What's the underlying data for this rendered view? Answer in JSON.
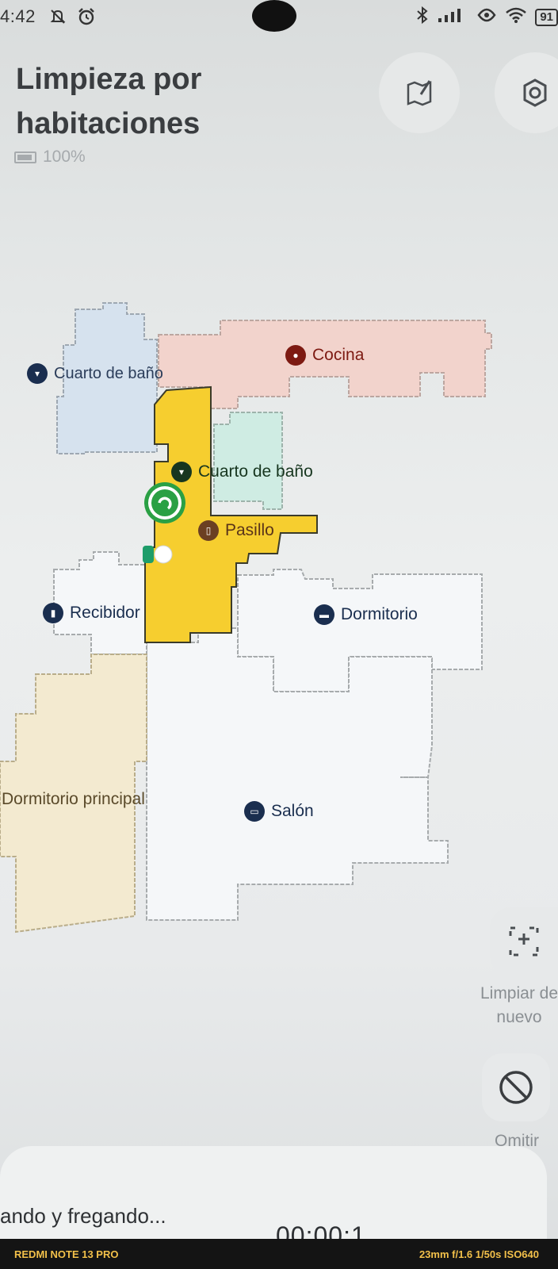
{
  "status_bar": {
    "time": "4:42",
    "battery": "91"
  },
  "header": {
    "title": "Limpieza por habitaciones",
    "battery_text": "100%"
  },
  "map": {
    "rooms": [
      {
        "name": "Cocina",
        "icon": "stove-icon"
      },
      {
        "name": "Cuarto de baño",
        "icon": "toilet-icon"
      },
      {
        "name": "Cuarto de baño",
        "icon": "toilet-icon"
      },
      {
        "name": "Pasillo",
        "icon": "door-icon"
      },
      {
        "name": "Recibidor",
        "icon": "door-icon"
      },
      {
        "name": "Dormitorio",
        "icon": "bed-icon"
      },
      {
        "name": "Dormitorio principal",
        "icon": "bed-icon"
      },
      {
        "name": "Salón",
        "icon": "sofa-icon"
      }
    ],
    "colors": {
      "kitchen": "#f2d3cc",
      "bathroom_left": "#d6e2ee",
      "bathroom_center": "#cfece3",
      "cleaning_path": "#f6ce2f",
      "master_bedroom": "#f3ead0",
      "default_room": "#f5f7f9"
    }
  },
  "actions": {
    "redo_label": "Limpiar de nuevo",
    "skip_label": "Omitir"
  },
  "bottom": {
    "status": "ando y fregando...",
    "timer": "00:00:1"
  },
  "watermark": {
    "device": "REDMI NOTE 13 PRO",
    "settings": "23mm  f/1.6  1/50s  ISO640"
  }
}
